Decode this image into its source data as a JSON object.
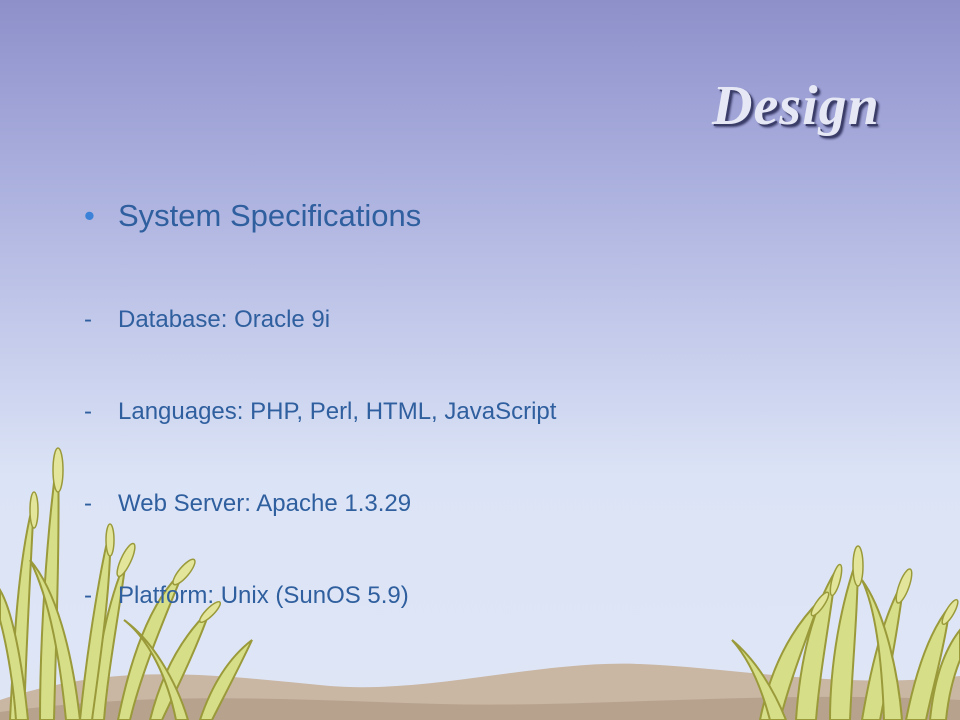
{
  "slide": {
    "title": "Design",
    "bullet": "System Specifications",
    "bullet_marker": "•",
    "items": [
      {
        "marker": "-",
        "text": "Database: Oracle 9i"
      },
      {
        "marker": "-",
        "text": "Languages: PHP, Perl, HTML, JavaScript"
      },
      {
        "marker": "-",
        "text": "Web Server: Apache 1.3.29"
      },
      {
        "marker": "-",
        "text": "Platform: Unix (SunOS 5.9)"
      }
    ]
  },
  "colors": {
    "background_top": "#8e90ca",
    "background_bottom": "#dfe6f6",
    "text": "#2f5f9e",
    "bullet_marker": "#3c82d8",
    "title": "#e6e8f6",
    "grass": "#d4dc86",
    "ground": "#c9b6a3"
  },
  "decoration": {
    "icon": "grass-illustration"
  }
}
